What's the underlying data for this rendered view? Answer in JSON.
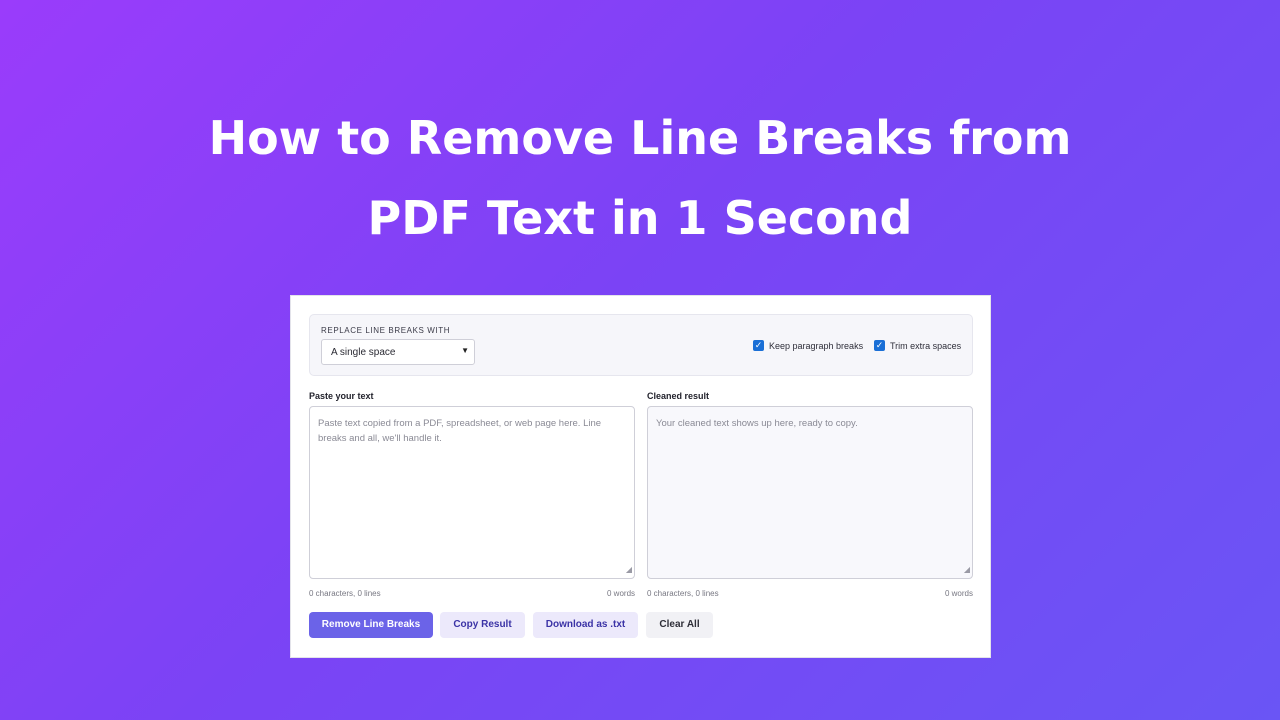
{
  "headline": {
    "line1": "How to Remove Line Breaks from",
    "line2": "PDF Text in 1 Second"
  },
  "options": {
    "replace_label": "REPLACE LINE BREAKS WITH",
    "selected_option": "A single space",
    "keep_paragraph": {
      "label": "Keep paragraph breaks",
      "checked": true
    },
    "trim_spaces": {
      "label": "Trim extra spaces",
      "checked": true
    }
  },
  "input": {
    "label": "Paste your text",
    "placeholder": "Paste text copied from a PDF, spreadsheet, or web page here. Line breaks and all, we'll handle it.",
    "stats_left": "0 characters, 0 lines",
    "stats_right": "0 words"
  },
  "output": {
    "label": "Cleaned result",
    "placeholder": "Your cleaned text shows up here, ready to copy.",
    "stats_left": "0 characters, 0 lines",
    "stats_right": "0 words"
  },
  "buttons": {
    "remove": "Remove Line Breaks",
    "copy": "Copy Result",
    "download": "Download as .txt",
    "clear": "Clear All"
  },
  "colors": {
    "accent": "#6b63e8",
    "checkbox": "#1a6fd6"
  }
}
